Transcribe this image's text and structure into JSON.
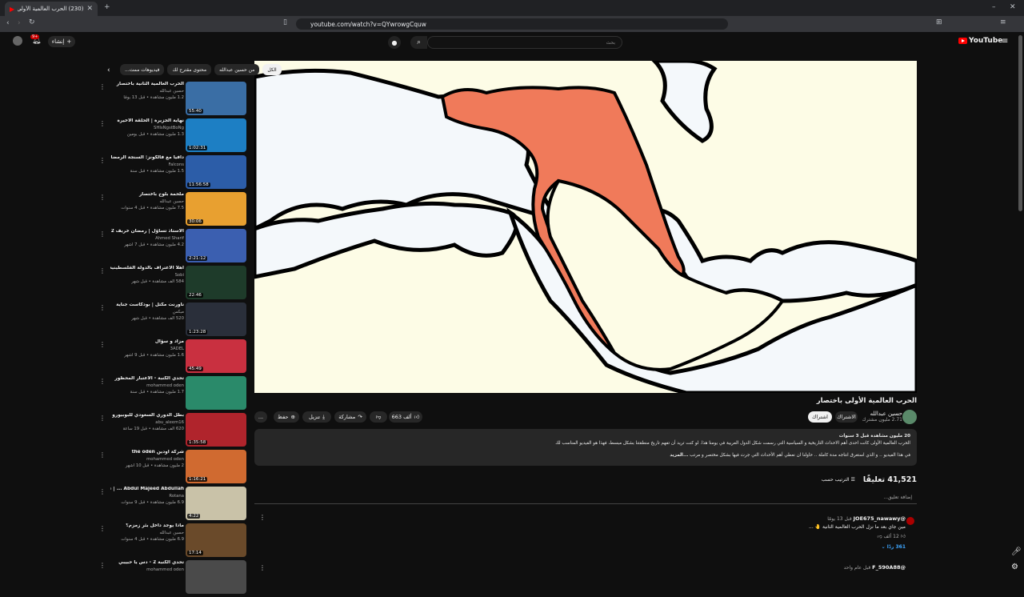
{
  "browser": {
    "tab_title": "(230) الحرب العالمية الأولى باخ...",
    "url": "youtube.com/watch?v=QYwrowgCquw",
    "new_tab": "+",
    "close": "✕"
  },
  "header": {
    "logo_text": "YouTube",
    "search_placeholder": "بحث",
    "create_label": "إنشاء",
    "notif_badge": "9+"
  },
  "video": {
    "title": "الحرب العالمية الأولى باختصار",
    "channel_name": "حسين عبدالله",
    "subscribers": "2.71 مليون مشترك",
    "subscribe_label": "اشتراك",
    "join_label": "الاشتراك",
    "likes": "663 ألف",
    "share_label": "مشاركة",
    "download_label": "تنزيل",
    "save_label": "حفظ",
    "more": "...",
    "map_colors": {
      "water": "#f4f8fb",
      "land": "#fdfce6",
      "ottoman": "#f07a5a"
    }
  },
  "description": {
    "stats": "20 مليون مشاهدة قبل 3 سنوات",
    "line1": "الحرب العالمية الأولى كانت احدى أهم الاحداث التاريخية و السياسية التي رسمت شكل الدول العربية في يومنا هذا. لو كنت تريد أن تفهم تاريخ منطقتنا بشكل مبسط، فهذا هو الفيديو المناسب لك",
    "line2": "في هذا الفيديو .. و الذي استغرق انتاجه مدة كاملة .. حاولنا ان نعطي أهم الأحداث التي جرت فيها بشكل مختصر و مرتب",
    "more": "...المزيد"
  },
  "comments": {
    "count": "41,521 تعليقًا",
    "sort": "الترتيب حسب",
    "add_placeholder": "إضافة تعليق...",
    "items": [
      {
        "user": "@JOE675_nawawy",
        "time": "قبل 13 يومًا",
        "text": "مين جاي بعد ما نزل الحرب العالمية الثانية 🤚 ...",
        "likes": "12 ألف",
        "replies": "361 ردًا"
      },
      {
        "user": "@F_590A88",
        "time": "قبل عام واحد",
        "text": "",
        "likes": "",
        "replies": ""
      }
    ]
  },
  "sidebar": {
    "chips": [
      "الكل",
      "من حسين عبدالله",
      "محتوى مقترح لك",
      "فيديوهات ممت..."
    ],
    "items": [
      {
        "title": "الحرب العالمية الثانية باختصار",
        "channel": "حسين عبدالله",
        "views": "1.2 مليون مشاهدة • قبل 13 يومًا",
        "duration": "55:40",
        "thumb": "#3a6ea5"
      },
      {
        "title": "نهاية الجزيرة | الحلقة الاخيرة",
        "channel": "SHIsNgstBoNg",
        "views": "1.3 مليون مشاهدة • قبل يومين",
        "duration": "1:02:31",
        "thumb": "#1d7fc4"
      },
      {
        "title": "دافيا مع فالكونز: السنجة الرمضانية",
        "channel": "Falcons",
        "views": "1.5 مليون مشاهدة • قبل سنة",
        "duration": "11:56:58",
        "thumb": "#2c5da8"
      },
      {
        "title": "ملحمة بلوخ باختصار",
        "channel": "حسين عبدالله",
        "views": "7.5 مليون مشاهدة • قبل 4 سنوات",
        "duration": "30:06",
        "thumb": "#e8a030"
      },
      {
        "title": "الأستاذ تساؤل | رمضان خريف 2",
        "channel": "Ahmed Sharif",
        "views": "4.2 مليون مشاهدة • قبل 7 أشهر",
        "duration": "2:21:12",
        "thumb": "#3b5fb0"
      },
      {
        "title": "اهلا الاعتراف بالدولة الفلسطينية مهم",
        "channel": "Sobi",
        "views": "584 ألف مشاهدة • قبل شهر",
        "duration": "22:46",
        "thumb": "#1e3b2a"
      },
      {
        "title": "ناورنت مكتل | بودكاست جناية",
        "channel": "ميكس",
        "views": "520 ألف مشاهدة • قبل شهر",
        "duration": "1:23:28",
        "thumb": "#2a2f3a"
      },
      {
        "title": "مزاد و سؤال",
        "channel": "3ADEL",
        "views": "1.6 مليون مشاهدة • قبل 9 أشهر",
        "duration": "45:49",
        "thumb": "#c93040"
      },
      {
        "title": "تحدي الكنبة - الاعتبار المحظور",
        "channel": "mohammed oden",
        "views": "1.7 مليون مشاهدة • قبل سنة",
        "duration": "",
        "thumb": "#2a8a6a"
      },
      {
        "title": "بطل الدوري السعودي للبوبيورو أمام 2025/26",
        "channel": "abu_aleem16",
        "views": "620 ألف مشاهدة • قبل 19 ساعة",
        "duration": "1:35:58",
        "thumb": "#b0242c"
      },
      {
        "title": "شركة اودين the oden",
        "channel": "mohammed oden",
        "views": "2 مليون مشاهدة • قبل 10 أشهر",
        "duration": "1:16:21",
        "thumb": "#d06a30"
      },
      {
        "title": "Abdul Majeed Abdullah ... | عبد المجيد عبد الله ... ealfat El Nass",
        "channel": "Rotana",
        "views": "6.9 مليون مشاهدة • قبل 9 سنوات",
        "duration": "4:22",
        "thumb": "#c9c2a8"
      },
      {
        "title": "ماذا يوجد داخل بئر زمزم؟",
        "channel": "حسين عبدالله",
        "views": "6.9 مليون مشاهدة • قبل 4 سنوات",
        "duration": "17:14",
        "thumb": "#6a4a2a"
      },
      {
        "title": "تحدي الكنبة 2 - دس يا حبيبي",
        "channel": "mohammed oden",
        "views": "",
        "duration": "",
        "thumb": "#4a4a4a"
      }
    ]
  }
}
